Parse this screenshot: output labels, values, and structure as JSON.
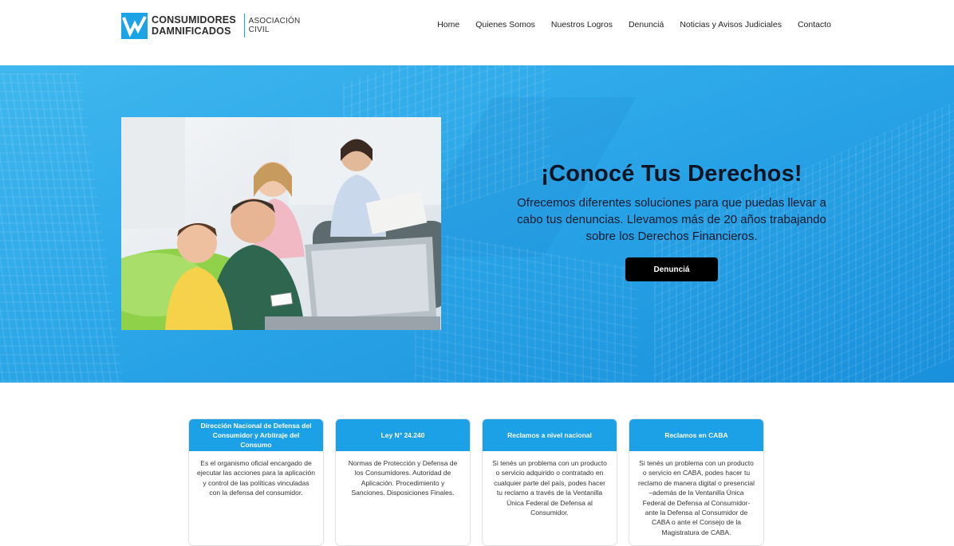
{
  "header": {
    "logo": {
      "line1": "CONSUMIDORES",
      "line2": "DAMNIFICADOS",
      "sub": "ASOCIACIÓN CIVIL",
      "icon": "logo-check-icon",
      "brand_color": "#1ba3e6"
    },
    "nav": [
      {
        "label": "Home"
      },
      {
        "label": "Quienes Somos"
      },
      {
        "label": "Nuestros Logros"
      },
      {
        "label": "Denunciá"
      },
      {
        "label": "Noticias y Avisos Judiciales"
      },
      {
        "label": "Contacto"
      }
    ]
  },
  "hero": {
    "title": "¡Conocé Tus Derechos!",
    "description": "Ofrecemos diferentes soluciones para que puedas llevar a cabo tus denuncias. Llevamos más de 20 años trabajando sobre los Derechos Financieros.",
    "button_label": "Denunciá",
    "background_color": "#2ba6e8"
  },
  "cards": [
    {
      "title": "Dirección Nacional de Defensa del Consumidor y Arbitraje del Consumo",
      "body": "Es el organismo oficial encargado de ejecutar las acciones para la aplicación y control de las políticas vinculadas con la defensa del consumidor."
    },
    {
      "title": "Ley N° 24.240",
      "body": "Normas de Protección y Defensa de los Consumidores. Autoridad de Aplicación. Procedimiento y Sanciones. Disposiciones Finales."
    },
    {
      "title": "Reclamos a nivel nacional",
      "body": "Si tenés un problema con un producto o servicio adquirido o contratado en cualquier parte del país, podes hacer tu reclamo a través de la Ventanilla Única Federal de Defensa al Consumidor."
    },
    {
      "title": "Reclamos en CABA",
      "body": "Si tenés un problema con un producto o servicio en CABA, podes hacer tu reclamo de manera digital o presencial –además de la Ventanilla Única Federal de Defensa al Consumidor- ante la Defensa al Consumidor de CABA o ante el Consejo de la Magistratura de CABA."
    }
  ]
}
